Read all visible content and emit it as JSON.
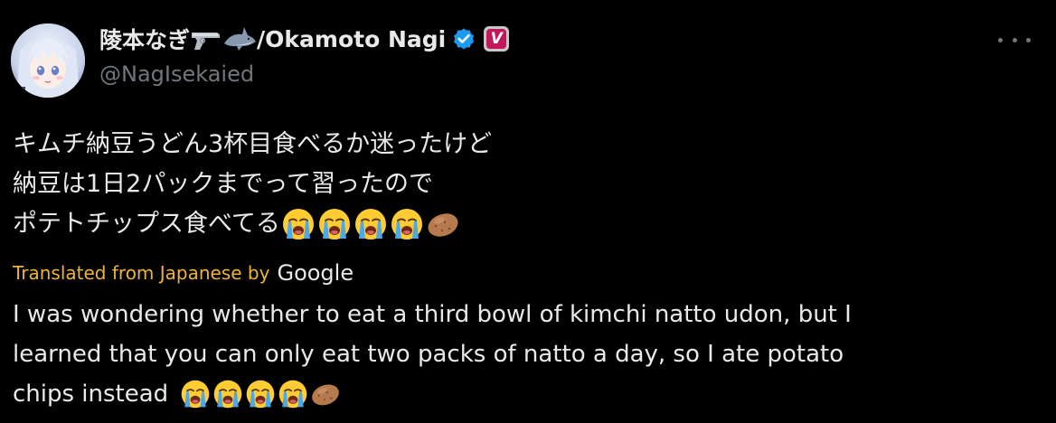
{
  "author": {
    "display_name": "陵本なぎ",
    "name_suffix": "/Okamoto Nagi",
    "handle": "@NagIsekaied",
    "name_emojis": [
      "pistol-emoji",
      "shark-emoji"
    ],
    "badges": [
      "verified-blue-check",
      "v-badge"
    ],
    "v_badge_label": "V"
  },
  "menu": {
    "more_icon": "more-horizontal-icon"
  },
  "tweet": {
    "jp_lines": [
      "キムチ納豆うどん3杯目食べるか迷ったけど",
      "納豆は1日2パックまでって習ったので",
      "ポテトチップス食べてる"
    ],
    "jp_trailing_emojis": [
      "loudly-crying-face",
      "loudly-crying-face",
      "loudly-crying-face",
      "loudly-crying-face",
      "potato"
    ],
    "translation_label": "Translated from Japanese by",
    "translation_provider": "Google",
    "en_lines": [
      "I was wondering whether to eat a third bowl of kimchi natto udon, but I",
      "learned that you can only eat two packs of natto a day, so I ate potato",
      "chips instead"
    ],
    "en_trailing_emojis": [
      "loudly-crying-face",
      "loudly-crying-face",
      "loudly-crying-face",
      "loudly-crying-face",
      "potato"
    ]
  },
  "colors": {
    "background": "#000000",
    "text_primary": "#e7e9ea",
    "text_secondary": "#71767b",
    "translation_accent": "#f0b33a",
    "verified_blue": "#1d9bf0",
    "v_badge_pink": "#c2185b"
  }
}
